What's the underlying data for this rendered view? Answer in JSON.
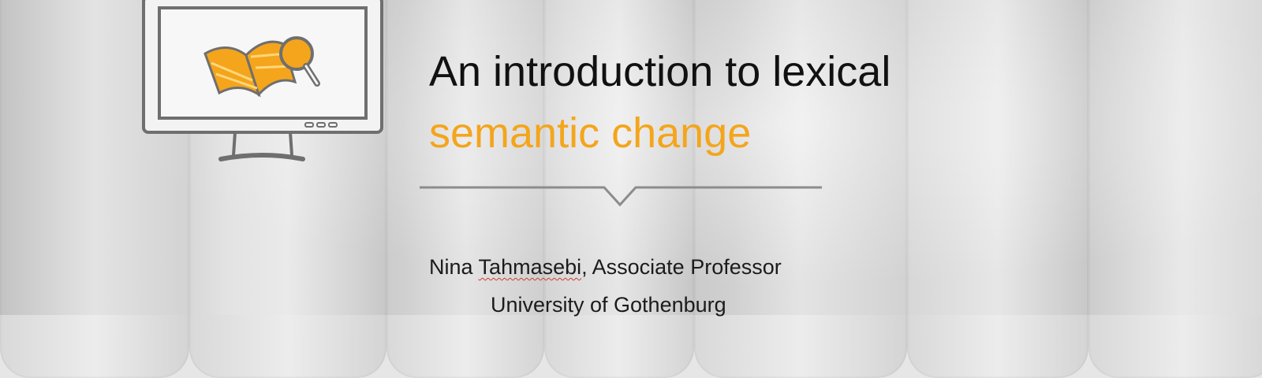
{
  "slide": {
    "title": "An introduction to lexical",
    "subtitle": "semantic change",
    "author_first": "Nina",
    "author_last": "Tahmasebi",
    "author_role": ", Associate Professor",
    "affiliation": "University of Gothenburg"
  },
  "colors": {
    "accent": "#f4a51c",
    "title_text": "#111111",
    "monitor_stroke": "#6f6f6f",
    "divider": "#8c8c8c"
  },
  "icons": [
    "monitor-icon",
    "book-icon",
    "magnifier-icon"
  ]
}
